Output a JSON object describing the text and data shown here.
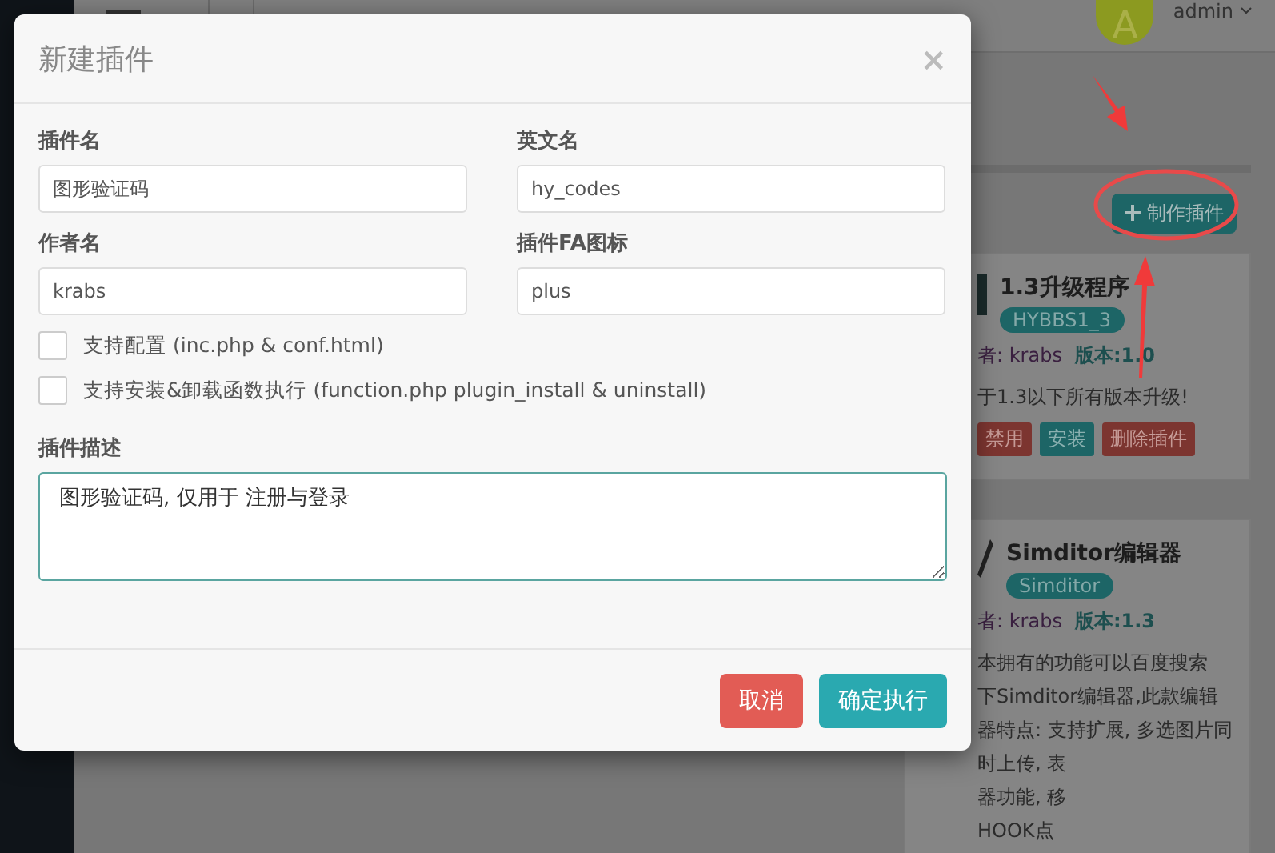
{
  "topbar": {
    "avatar_letter": "A",
    "user": "admin"
  },
  "make_button": {
    "label": "制作插件"
  },
  "plugins": [
    {
      "title": "1.3升级程序",
      "tag": "HYBBS1_3",
      "author": "者: krabs",
      "version": "版本:1.0",
      "description": [
        "于1.3以下所有版本升级!"
      ],
      "actions": [
        {
          "label": "禁用",
          "kind": "danger"
        },
        {
          "label": "安装",
          "kind": "primary"
        },
        {
          "label": "删除插件",
          "kind": "danger"
        }
      ]
    },
    {
      "title": "Simditor编辑器",
      "tag": "Simditor",
      "author": "者: krabs",
      "version": "版本:1.3",
      "description": [
        "本拥有的功能可以百度搜索",
        "下Simditor编辑器,此款编辑",
        "器特点: 支持扩展, 多选图片同",
        "时上传, 表",
        "器功能, 移",
        "HOOK点"
      ]
    }
  ],
  "dialog": {
    "title": "新建插件",
    "close": "×",
    "fields": [
      {
        "label": "插件名",
        "value": "图形验证码"
      },
      {
        "label": "英文名",
        "value": "hy_codes"
      },
      {
        "label": "作者名",
        "value": "krabs"
      },
      {
        "label": "插件FA图标",
        "value": "plus"
      }
    ],
    "options": [
      {
        "label": "支持配置 (inc.php & conf.html)",
        "checked": false
      },
      {
        "label": "支持安装&卸载函数执行 (function.php plugin_install & uninstall)",
        "checked": false
      }
    ],
    "description": {
      "label": "插件描述",
      "value": "图形验证码, 仅用于 注册与登录"
    },
    "buttons": [
      {
        "label": "取消",
        "kind": "danger"
      },
      {
        "label": "确定执行",
        "kind": "primary"
      }
    ]
  }
}
